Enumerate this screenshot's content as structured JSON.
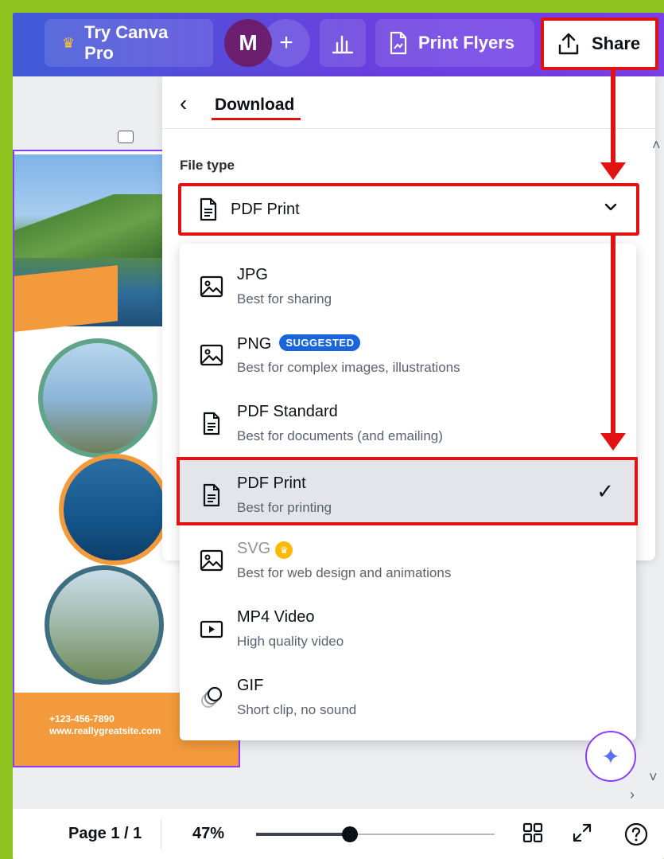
{
  "topbar": {
    "pro_label": "Try Canva Pro",
    "avatar_letter": "M",
    "add_label": "+",
    "print_label": "Print Flyers",
    "share_label": "Share"
  },
  "download_panel": {
    "title": "Download",
    "file_type_label": "File type",
    "selected_value": "PDF Print"
  },
  "file_types": [
    {
      "name": "JPG",
      "desc": "Best for sharing"
    },
    {
      "name": "PNG",
      "desc": "Best for complex images, illustrations",
      "badge": "SUGGESTED"
    },
    {
      "name": "PDF Standard",
      "desc": "Best for documents (and emailing)"
    },
    {
      "name": "PDF Print",
      "desc": "Best for printing",
      "selected": true
    },
    {
      "name": "SVG",
      "desc": "Best for web design and animations",
      "pro": true
    },
    {
      "name": "MP4 Video",
      "desc": "High quality video"
    },
    {
      "name": "GIF",
      "desc": "Short clip, no sound"
    }
  ],
  "design": {
    "phone": "+123-456-7890",
    "website": "www.reallygreatsite.com"
  },
  "bottombar": {
    "page_info": "Page 1 / 1",
    "zoom": "47%",
    "zoom_level_percent": 47
  },
  "colors": {
    "accent_red": "#e31212",
    "brand_purple": "#8b3dff",
    "badge_blue": "#1a64dc"
  }
}
